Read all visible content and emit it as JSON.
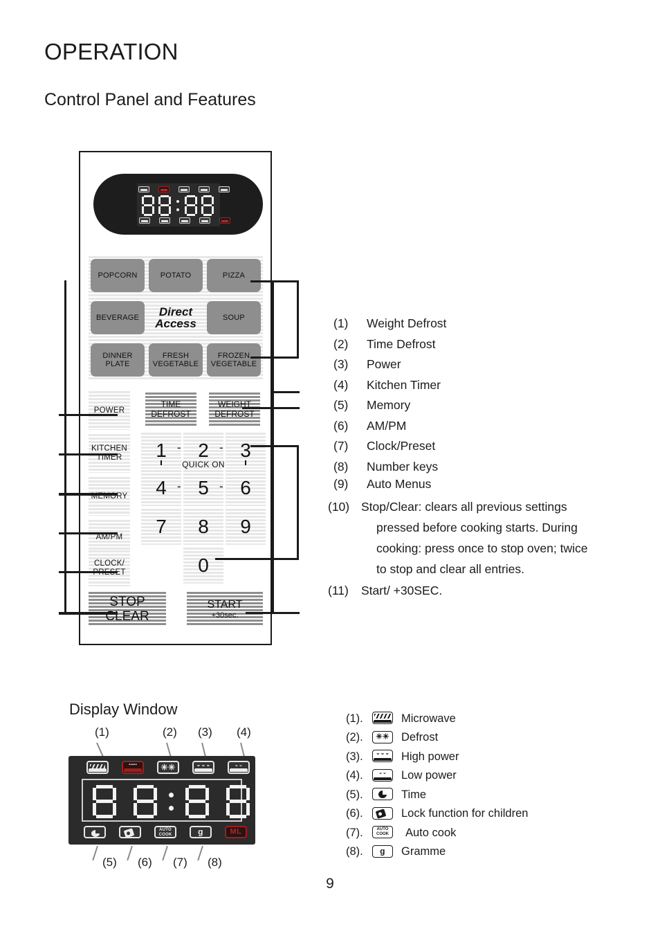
{
  "page_title": "OPERATION",
  "section_title": "Control Panel and Features",
  "page_number": "9",
  "control_panel": {
    "auto_menu_buttons": [
      {
        "label": "POPCORN"
      },
      {
        "label": "POTATO"
      },
      {
        "label": "PIZZA"
      },
      {
        "label": "BEVERAGE"
      },
      {
        "label": "Direct Access",
        "line1": "Direct",
        "line2": "Access"
      },
      {
        "label": "SOUP"
      },
      {
        "label": "DINNER PLATE",
        "line1": "DINNER",
        "line2": "PLATE"
      },
      {
        "label": "FRESH VEGETABLE",
        "line1": "FRESH",
        "line2": "VEGETABLE"
      },
      {
        "label": "FROZEN VEGETABLE",
        "line1": "FROZEN",
        "line2": "VEGETABLE"
      }
    ],
    "function_keys": [
      {
        "line1": "POWER",
        "line2": ""
      },
      {
        "line1": "KITCHEN",
        "line2": "TIMER"
      },
      {
        "line1": "MEMORY",
        "line2": ""
      },
      {
        "line1": "AM/PM",
        "line2": ""
      },
      {
        "line1": "CLOCK/",
        "line2": "PRESET"
      }
    ],
    "defrost_keys": [
      {
        "line1": "TIME",
        "line2": "DEFROST"
      },
      {
        "line1": "WEIGHT",
        "line2": "DEFROST"
      }
    ],
    "number_keys": [
      "1",
      "2",
      "3",
      "4",
      "5",
      "6",
      "7",
      "8",
      "9",
      "0"
    ],
    "quick_on_label": "QUICK ON",
    "stop_key": {
      "line1": "STOP",
      "line2": "CLEAR"
    },
    "start_key": {
      "line1": "START",
      "line2": "+30sec."
    }
  },
  "features_legend": [
    {
      "num": "(1)",
      "text": "Weight Defrost"
    },
    {
      "num": "(2)",
      "text": "Time Defrost"
    },
    {
      "num": "(3)",
      "text": "Power"
    },
    {
      "num": "(4)",
      "text": "Kitchen Timer"
    },
    {
      "num": "(5)",
      "text": "Memory"
    },
    {
      "num": "(6)",
      "text": "AM/PM"
    },
    {
      "num": "(7)",
      "text": "Clock/Preset"
    },
    {
      "num": "(8)",
      "text": "Number keys"
    },
    {
      "num": "(9)",
      "text": "Auto Menus"
    }
  ],
  "features_legend_long": {
    "num": "(10)",
    "line1": "Stop/Clear: clears all previous settings",
    "line2": "pressed before cooking starts. During",
    "line3": "cooking: press once to stop oven; twice",
    "line4": "to stop and clear all entries."
  },
  "features_legend_last": {
    "num": "(11)",
    "text": "Start/ +30SEC."
  },
  "display_window": {
    "title": "Display  Window",
    "top_callouts": [
      "(1)",
      "(2)",
      "(3)",
      "(4)"
    ],
    "bottom_callouts": [
      "(5)",
      "(6)",
      "(7)",
      "(8)"
    ],
    "indicator_ml": "ML",
    "indicator_g": "g",
    "indicator_autocook_line1": "AUTO",
    "indicator_autocook_line2": "COOK",
    "legend": [
      {
        "num": "(1).",
        "icon": "microwave-icon",
        "text": "Microwave"
      },
      {
        "num": "(2).",
        "icon": "defrost-icon",
        "text": "Defrost"
      },
      {
        "num": "(3).",
        "icon": "high-power-icon",
        "text": "High power"
      },
      {
        "num": "(4).",
        "icon": "low-power-icon",
        "text": "Low power"
      },
      {
        "num": "(5).",
        "icon": "time-icon",
        "text": "Time"
      },
      {
        "num": "(6).",
        "icon": "child-lock-icon",
        "text": "Lock function for children"
      },
      {
        "num": "(7).",
        "icon": "auto-cook-icon",
        "text": "Auto cook"
      },
      {
        "num": "(8).",
        "icon": "gramme-icon",
        "text": "Gramme"
      }
    ]
  },
  "colors": {
    "panel_border": "#1a1a1a",
    "button_gray": "#8e8e8e",
    "display_black": "#2b2b2b",
    "indicator_red": "#9e1f1f",
    "text": "#1b1b1b"
  }
}
